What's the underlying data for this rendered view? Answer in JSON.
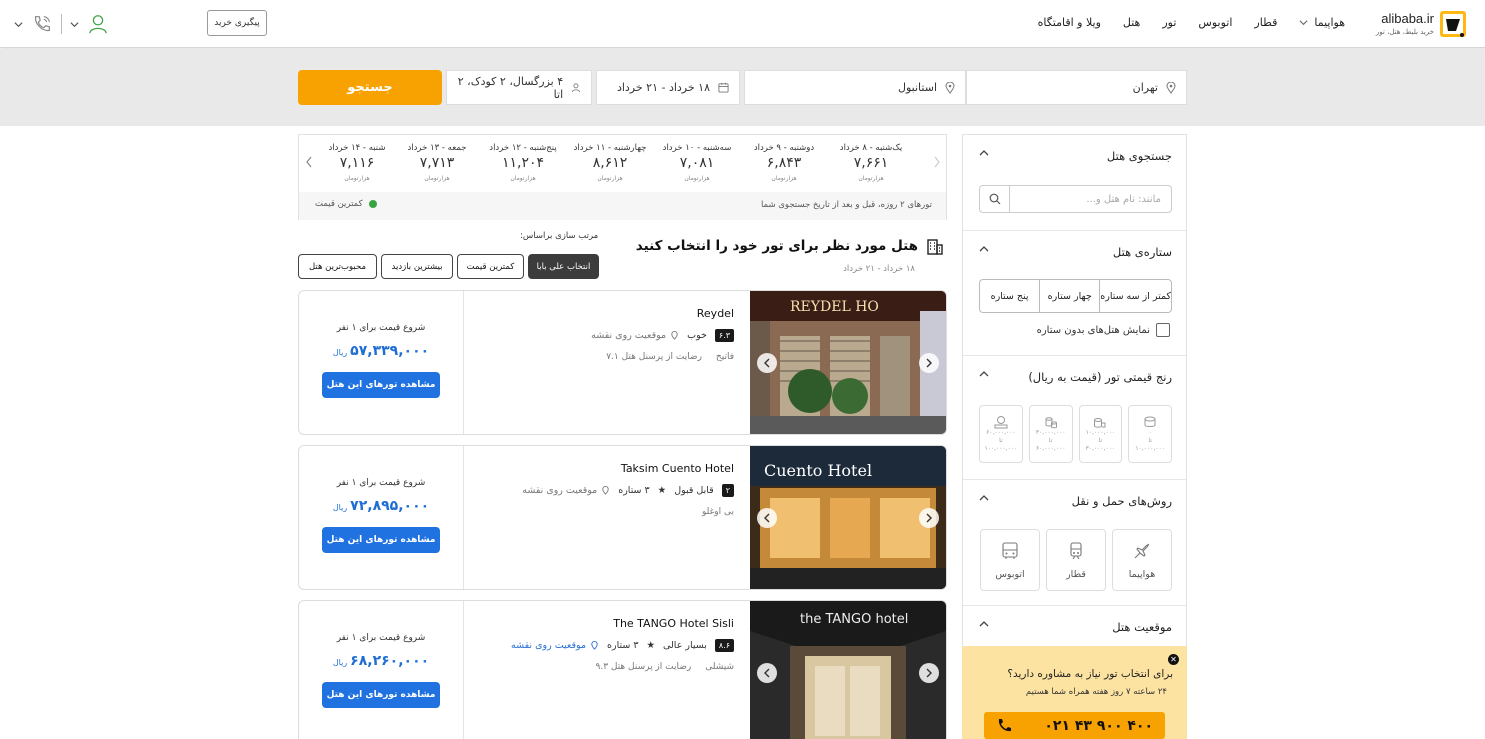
{
  "header": {
    "brand": "alibaba.ir",
    "tagline": "خرید بلیط، هتل، تور",
    "nav": [
      "هواپیما",
      "قطار",
      "اتوبوس",
      "تور",
      "هتل",
      "ویلا و اقامتگاه"
    ],
    "track_order": "پیگیری خرید"
  },
  "search": {
    "origin": "تهران",
    "destination": "استانبول",
    "dates": "۱۸ خرداد - ۲۱ خرداد",
    "passengers": "۴ بزرگسال، ۲ کودک، ۲ اتا",
    "button": "جستجو"
  },
  "date_strip": {
    "unit": "هزارتومان",
    "days": [
      {
        "label": "یک‌شنبه - ۸ خرداد",
        "price": "۷,۶۶۱"
      },
      {
        "label": "دوشنبه - ۹ خرداد",
        "price": "۶,۸۴۳"
      },
      {
        "label": "سه‌شنبه - ۱۰ خرداد",
        "price": "۷,۰۸۱"
      },
      {
        "label": "چهارشنبه - ۱۱ خرداد",
        "price": "۸,۶۱۲"
      },
      {
        "label": "پنج‌شنبه - ۱۲ خرداد",
        "price": "۱۱,۲۰۴"
      },
      {
        "label": "جمعه - ۱۳ خرداد",
        "price": "۷,۷۱۳"
      },
      {
        "label": "شنبه - ۱۴ خرداد",
        "price": "۷,۱۱۶"
      }
    ],
    "note": "تورهای ۲ روزه، قبل و بعد از تاریخ جستجوی شما",
    "legend": "کمترین قیمت"
  },
  "results": {
    "title": "هتل مورد نظر برای تور خود را انتخاب کنید",
    "dates": "۱۸ خرداد - ۲۱ خرداد",
    "sort_label": "مرتب سازی براساس:",
    "sort_options": [
      "انتخاب علی بابا",
      "کمترین قیمت",
      "بیشترین بازدید",
      "محبوب‌ترین هتل"
    ]
  },
  "hotels": [
    {
      "name": "Reydel",
      "rating": "۶.۳",
      "rating_text": "خوب",
      "stars": "",
      "map": "موقعیت روی نقشه",
      "area": "فاتیح",
      "satisfaction": "رضایت از پرسنل هتل ۷.۱",
      "from": "شروع قیمت برای ۱ نفر",
      "price": "۵۷,۳۳۹,۰۰۰",
      "currency": "ریال",
      "cta": "مشاهده تورهای این هتل",
      "photo_text": "REYDEL HO"
    },
    {
      "name": "Taksim Cuento Hotel",
      "rating": "۲",
      "rating_text": "قابل قبول",
      "stars": "۳ ستاره",
      "map": "موقعیت روی نقشه",
      "area": "بی اوغلو",
      "satisfaction": "",
      "from": "شروع قیمت برای ۱ نفر",
      "price": "۷۲,۸۹۵,۰۰۰",
      "currency": "ریال",
      "cta": "مشاهده تورهای این هتل",
      "photo_text": "Cuento Hotel"
    },
    {
      "name": "The TANGO Hotel Sisli",
      "rating": "۸.۶",
      "rating_text": "بسیار عالی",
      "stars": "۳ ستاره",
      "map": "موقعیت روی نقشه",
      "area": "شیشلی",
      "satisfaction": "رضایت از پرسنل هتل ۹.۳",
      "from": "شروع قیمت برای ۱ نفر",
      "price": "۶۸,۲۶۰,۰۰۰",
      "currency": "ریال",
      "cta": "مشاهده تورهای این هتل",
      "photo_text": "the TANGO hotel"
    }
  ],
  "filters": {
    "hotel_search": {
      "title": "جستجوی هتل",
      "placeholder": "مانند: نام هتل و..."
    },
    "stars": {
      "title": "ستاره‌ی هتل",
      "options": [
        "کمتر از سه ستاره",
        "چهار ستاره",
        "پنج ستاره"
      ],
      "no_star": "نمایش هتل‌های بدون ستاره"
    },
    "price_range": {
      "title": "رنج قیمتی تور (قیمت به ریال)",
      "ranges": [
        {
          "from": "۰",
          "to": "۱۰,۰۰۰,۰۰۰"
        },
        {
          "from": "۱۰,۰۰۰,۰۰۰",
          "to": "۳۰,۰۰۰,۰۰۰"
        },
        {
          "from": "۳۰,۰۰۰,۰۰۰",
          "to": "۶۰,۰۰۰,۰۰۰"
        },
        {
          "from": "۶۰,۰۰۰,۰۰۰",
          "to": "۱۰۰,۰۰۰,۰۰۰"
        }
      ],
      "separator": "تا"
    },
    "transport": {
      "title": "روش‌های حمل و نقل",
      "options": [
        "هواپیما",
        "قطار",
        "اتوبوس"
      ]
    },
    "location": {
      "title": "موقعیت هتل"
    }
  },
  "consult": {
    "question": "برای انتخاب تور نیاز به مشاوره دارید؟",
    "sub": "۲۴ ساعته ۷ روز هفته همراه شما هستیم",
    "phone": "۰۲۱ ۴۳ ۹۰۰ ۴۰۰"
  },
  "colors": {
    "accent": "#f7a200",
    "primary": "#1f72e0",
    "dark": "#3c3c3c"
  }
}
